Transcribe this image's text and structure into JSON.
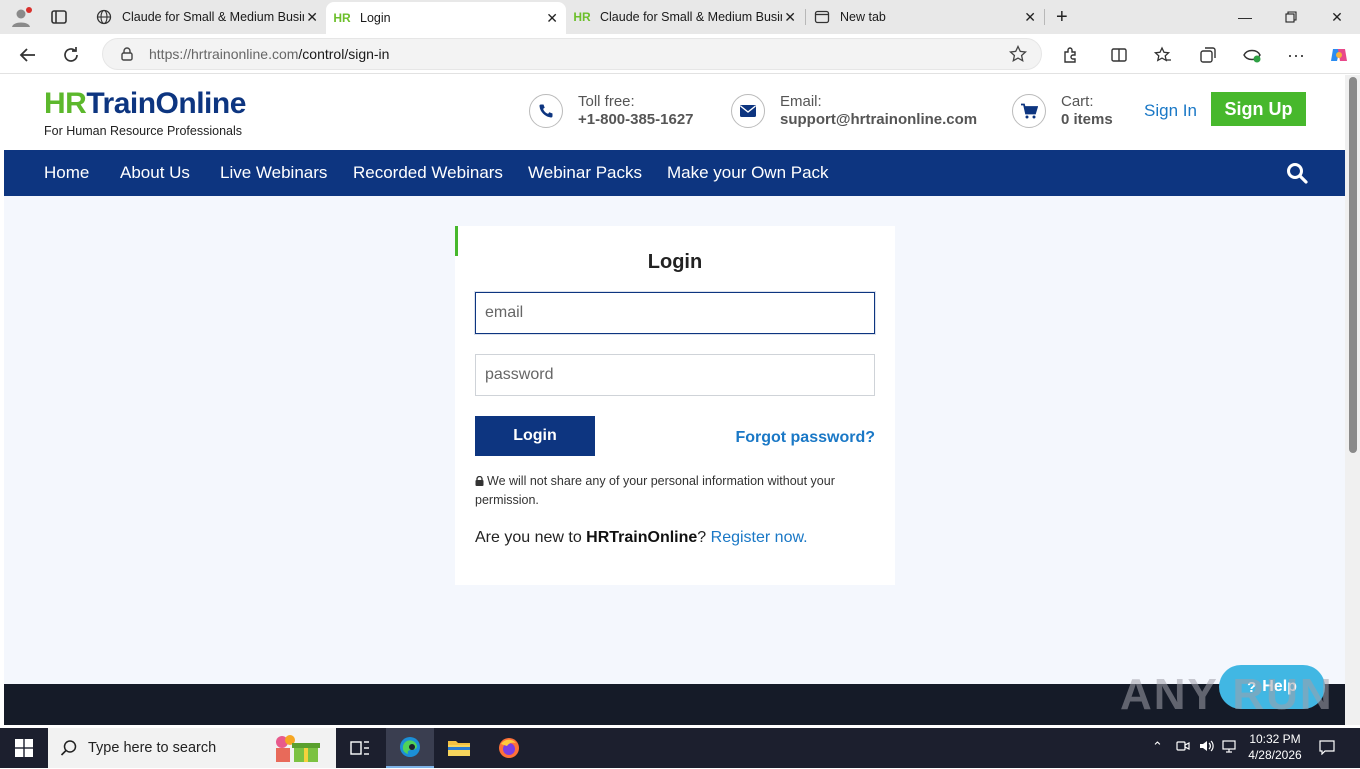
{
  "browser": {
    "tabs": [
      {
        "title": "Claude for Small & Medium Busin",
        "favicon": "globe-icon",
        "active": false
      },
      {
        "title": "Login",
        "favicon": "HR",
        "active": true
      },
      {
        "title": "Claude for Small & Medium Busin",
        "favicon": "HR",
        "active": false
      },
      {
        "title": "New tab",
        "favicon": "newtab-icon",
        "active": false
      }
    ],
    "url_host": "https://hrtrainonline.com",
    "url_path": "/control/sign-in"
  },
  "site": {
    "logo_part1": "HR",
    "logo_part2": "TrainOnline",
    "tagline": "For Human Resource Professionals",
    "tollfree_label": "Toll free:",
    "tollfree_value": "+1-800-385-1627",
    "email_label": "Email:",
    "email_value": "support@hrtrainonline.com",
    "cart_label": "Cart:",
    "cart_value": "0 items",
    "signin": "Sign In",
    "signup": "Sign Up",
    "nav": [
      "Home",
      "About Us",
      "Live Webinars",
      "Recorded Webinars",
      "Webinar Packs",
      "Make your Own Pack"
    ],
    "colors": {
      "brand_blue": "#0d3580",
      "brand_green": "#47b82c",
      "link_blue": "#1a78c6"
    }
  },
  "login": {
    "title": "Login",
    "email_placeholder": "email",
    "password_placeholder": "password",
    "button": "Login",
    "forgot": "Forgot password?",
    "privacy": "We will not share any of your personal information without your permission.",
    "register_prefix": "Are you new to ",
    "register_brand": "HRTrainOnline",
    "register_q": "? ",
    "register_link": "Register now."
  },
  "overlay": {
    "help": "Help",
    "watermark": "ANY RUN"
  },
  "taskbar": {
    "search_placeholder": "Type here to search",
    "time": "10:32 PM",
    "date": "4/28/2026"
  }
}
